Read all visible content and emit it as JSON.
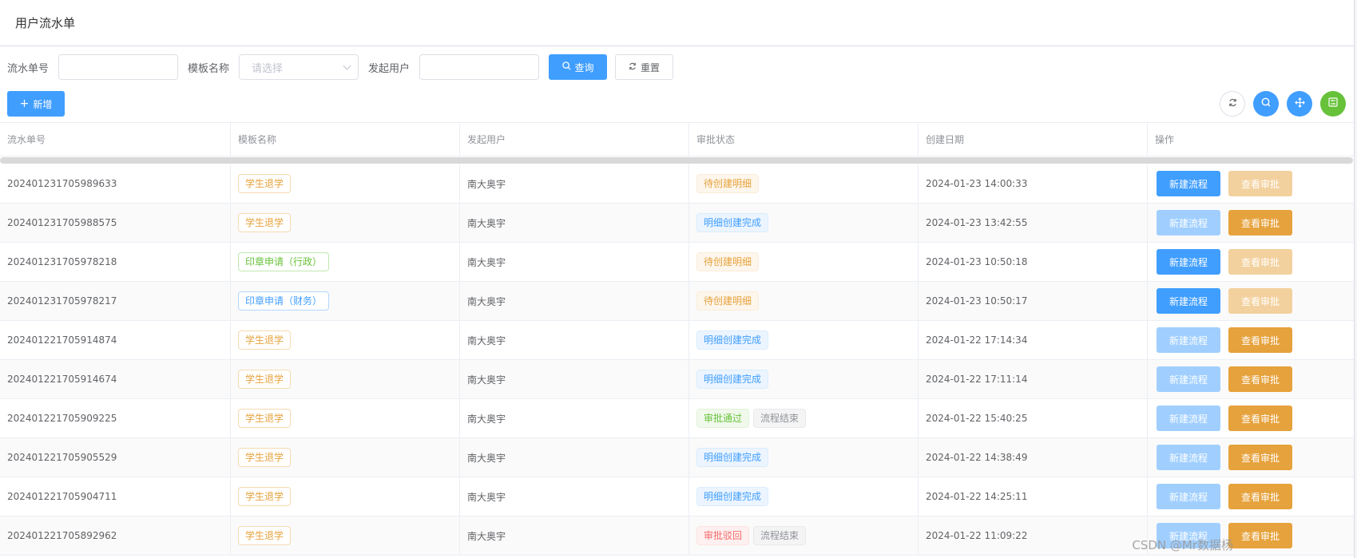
{
  "page": {
    "title": "用户流水单"
  },
  "search": {
    "serial_label": "流水单号",
    "serial_value": "",
    "template_label": "模板名称",
    "template_placeholder": "请选择",
    "initiator_label": "发起用户",
    "initiator_value": "",
    "query_label": "查询",
    "reset_label": "重置"
  },
  "toolbar": {
    "add_label": "新增",
    "icons": [
      "refresh-icon",
      "search-icon",
      "move-icon",
      "columns-icon"
    ]
  },
  "table": {
    "headers": [
      "流水单号",
      "模板名称",
      "发起用户",
      "审批状态",
      "创建日期",
      "操作"
    ],
    "action_labels": {
      "new_flow": "新建流程",
      "view_approval": "查看审批"
    },
    "rows": [
      {
        "serial": "202401231705989633",
        "template": "学生退学",
        "template_color": "orange",
        "user": "南大奥宇",
        "status": [
          {
            "text": "待创建明细",
            "type": "orange"
          }
        ],
        "date": "2024-01-23 14:00:33",
        "new_enabled": true,
        "view_enabled": false
      },
      {
        "serial": "202401231705988575",
        "template": "学生退学",
        "template_color": "orange",
        "user": "南大奥宇",
        "status": [
          {
            "text": "明细创建完成",
            "type": "blue"
          }
        ],
        "date": "2024-01-23 13:42:55",
        "new_enabled": false,
        "view_enabled": true
      },
      {
        "serial": "202401231705978218",
        "template": "印章申请（行政）",
        "template_color": "green",
        "user": "南大奥宇",
        "status": [
          {
            "text": "待创建明细",
            "type": "orange"
          }
        ],
        "date": "2024-01-23 10:50:18",
        "new_enabled": true,
        "view_enabled": false
      },
      {
        "serial": "202401231705978217",
        "template": "印章申请（财务）",
        "template_color": "blue",
        "user": "南大奥宇",
        "status": [
          {
            "text": "待创建明细",
            "type": "orange"
          }
        ],
        "date": "2024-01-23 10:50:17",
        "new_enabled": true,
        "view_enabled": false
      },
      {
        "serial": "202401221705914874",
        "template": "学生退学",
        "template_color": "orange",
        "user": "南大奥宇",
        "status": [
          {
            "text": "明细创建完成",
            "type": "blue"
          }
        ],
        "date": "2024-01-22 17:14:34",
        "new_enabled": false,
        "view_enabled": true
      },
      {
        "serial": "202401221705914674",
        "template": "学生退学",
        "template_color": "orange",
        "user": "南大奥宇",
        "status": [
          {
            "text": "明细创建完成",
            "type": "blue"
          }
        ],
        "date": "2024-01-22 17:11:14",
        "new_enabled": false,
        "view_enabled": true
      },
      {
        "serial": "202401221705909225",
        "template": "学生退学",
        "template_color": "orange",
        "user": "南大奥宇",
        "status": [
          {
            "text": "审批通过",
            "type": "green"
          },
          {
            "text": "流程结束",
            "type": "info"
          }
        ],
        "date": "2024-01-22 15:40:25",
        "new_enabled": false,
        "view_enabled": true
      },
      {
        "serial": "202401221705905529",
        "template": "学生退学",
        "template_color": "orange",
        "user": "南大奥宇",
        "status": [
          {
            "text": "明细创建完成",
            "type": "blue"
          }
        ],
        "date": "2024-01-22 14:38:49",
        "new_enabled": false,
        "view_enabled": true
      },
      {
        "serial": "202401221705904711",
        "template": "学生退学",
        "template_color": "orange",
        "user": "南大奥宇",
        "status": [
          {
            "text": "明细创建完成",
            "type": "blue"
          }
        ],
        "date": "2024-01-22 14:25:11",
        "new_enabled": false,
        "view_enabled": true
      },
      {
        "serial": "202401221705892962",
        "template": "学生退学",
        "template_color": "orange",
        "user": "南大奥宇",
        "status": [
          {
            "text": "审批驳回",
            "type": "red"
          },
          {
            "text": "流程结束",
            "type": "info"
          }
        ],
        "date": "2024-01-22 11:09:22",
        "new_enabled": false,
        "view_enabled": true
      }
    ]
  },
  "watermark": "CSDN @Mr数据杨"
}
